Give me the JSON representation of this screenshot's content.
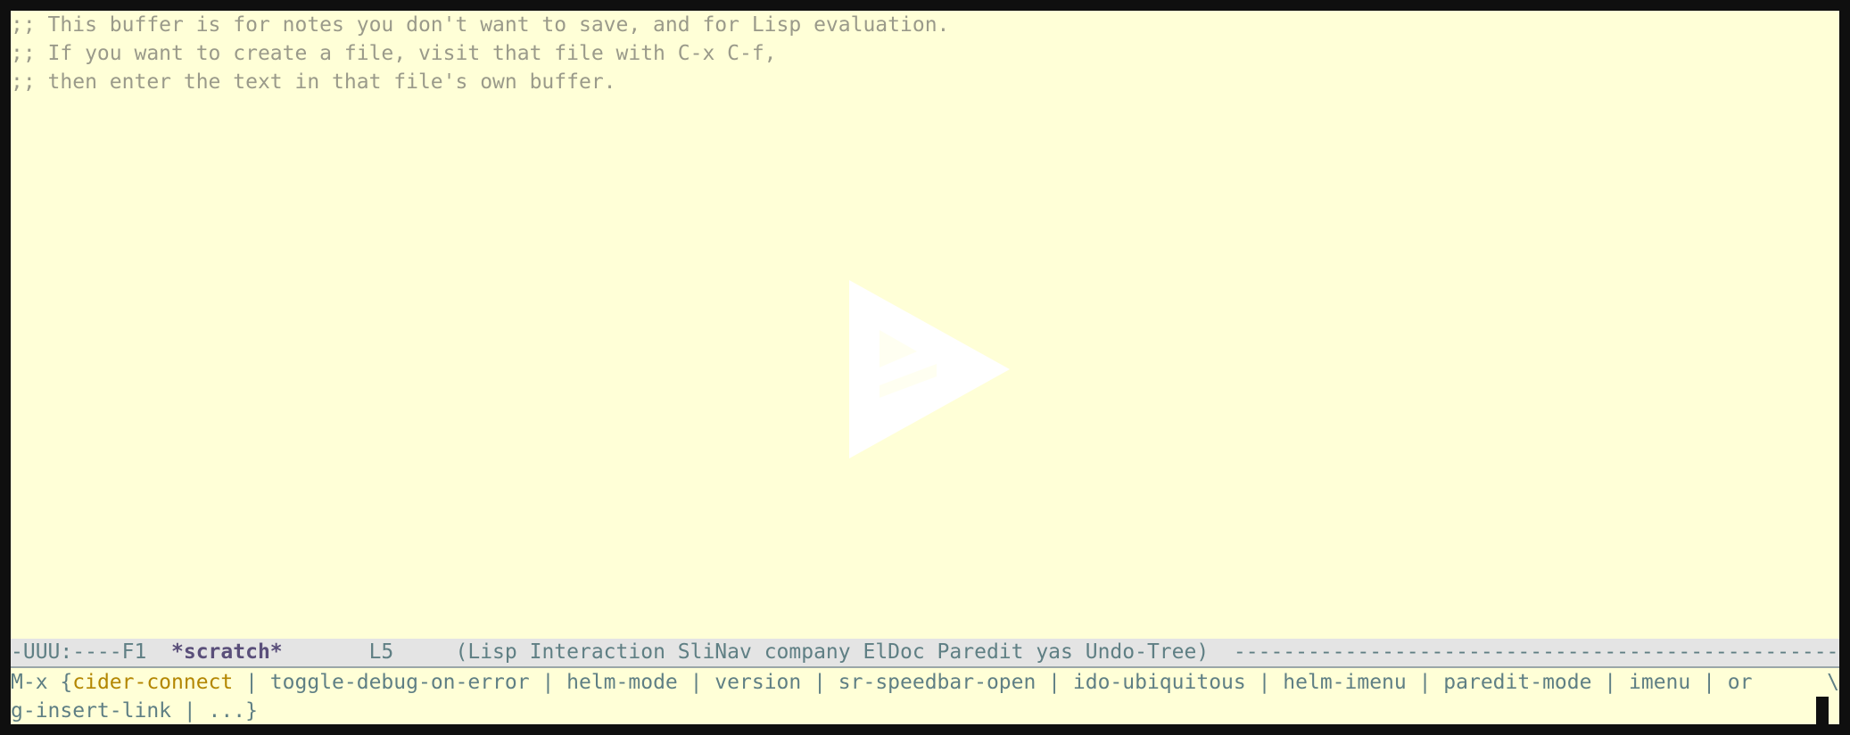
{
  "buffer": {
    "lines": [
      ";; This buffer is for notes you don't want to save, and for Lisp evaluation.",
      ";; If you want to create a file, visit that file with C-x C-f,",
      ";; then enter the text in that file's own buffer."
    ]
  },
  "modeline": {
    "status": "-UUU:----F1  ",
    "buffer_name": "*scratch*",
    "line_pos": "       L5     ",
    "modes": "(Lisp Interaction SliNav company ElDoc Paredit yas Undo-Tree)",
    "dashes": "  -------------------------------------------------------------------------"
  },
  "minibuffer": {
    "prompt": "M-x {",
    "selected": "cider-connect",
    "rest_line1": " | toggle-debug-on-error | helm-mode | version | sr-speedbar-open | ido-ubiquitous | helm-imenu | paredit-mode | imenu | or",
    "continuation_mark": "\\",
    "line2": "g-insert-link | ...}"
  },
  "colors": {
    "background": "#ffffd7",
    "comment": "#9a9a8a",
    "modeline_bg": "#e4e4e4",
    "modeline_fg": "#5f7f84",
    "buffer_name": "#5a4f7a",
    "selected_candidate": "#b38600"
  },
  "icons": {
    "watermark": "emacs-play-logo-icon"
  }
}
